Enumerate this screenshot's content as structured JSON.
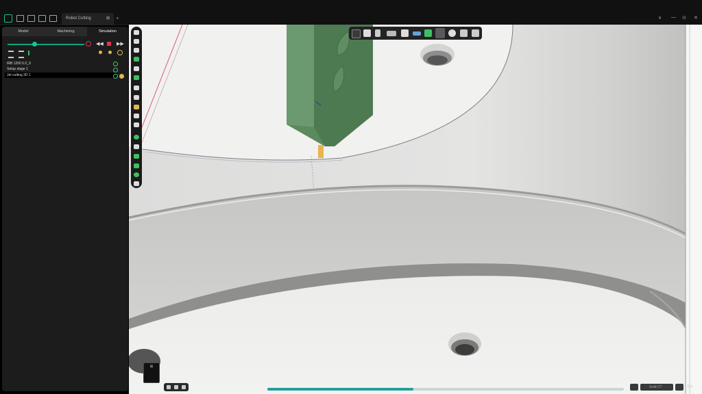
{
  "titlebar": {
    "tab_title": "Robot Cutting",
    "tab_close": "⊞",
    "add_tab": "+"
  },
  "window_controls": {
    "minimize": "∨",
    "restore": "—",
    "maximize": "⊙",
    "close": "✕"
  },
  "left_panel": {
    "tabs": [
      {
        "label": "Model"
      },
      {
        "label": "Machining"
      },
      {
        "label": "Simulation"
      }
    ],
    "active_tab": "Simulation",
    "simulation": {
      "progress": 0.35
    },
    "tree": [
      {
        "label": "IRB 1200 5.0_9"
      },
      {
        "label": "Setup stage 1"
      },
      {
        "label": "Jet cutting 3D 1"
      }
    ]
  },
  "viewport": {
    "tools_icons": [
      "select-icon",
      "camera-icon",
      "tool-icon",
      "axes-icon",
      "grid-icon",
      "vector-icon",
      "layer-icon",
      "shade-icon",
      "settings-icon",
      "list-icon",
      "expand-icon"
    ],
    "nav_cube_label": "⊞"
  },
  "status": {
    "playback_progress": 0.41,
    "status_label": "Gold CT",
    "zoom_label": "9%"
  },
  "colors": {
    "accent": "#10a37f",
    "tool_green": "#5b8a5e",
    "stop_red": "#e0334b"
  }
}
